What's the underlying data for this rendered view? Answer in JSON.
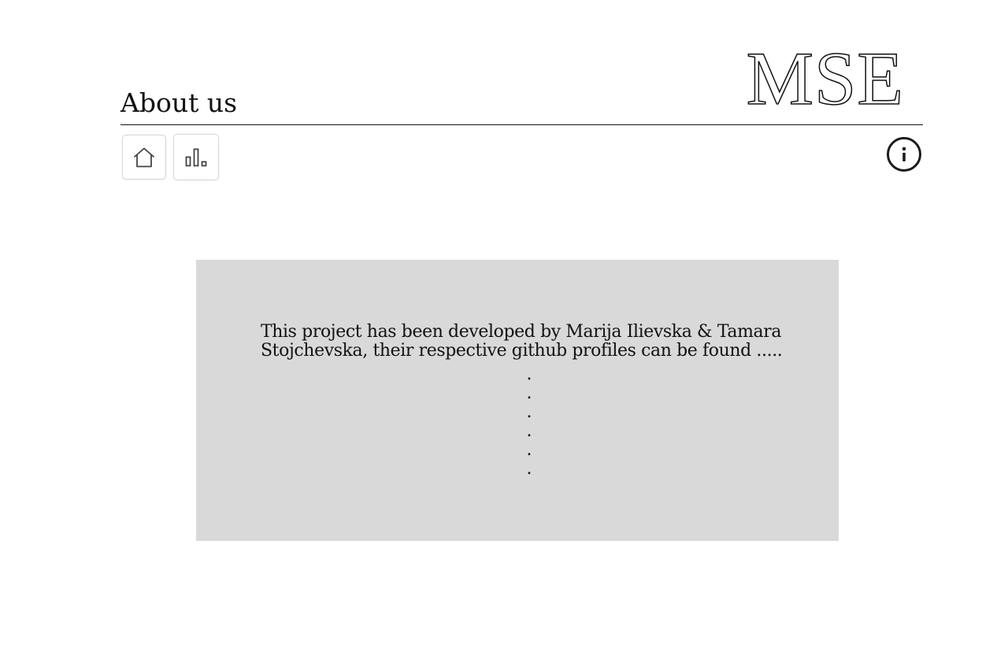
{
  "header": {
    "title": "About us",
    "logo_text": "MSE"
  },
  "nav": {
    "home_icon": "home-icon",
    "stats_icon": "bar-chart-icon",
    "info_icon": "info-icon"
  },
  "content": {
    "text": "This project has been developed by Marija Ilievska & Tamara Stojchevska, their respective github profiles can be found .....",
    "dots": [
      ".",
      ".",
      ".",
      ".",
      ".",
      "."
    ]
  },
  "colors": {
    "content_background": "#d9d9d9",
    "text": "#111111",
    "button_border": "#d6d6d6"
  }
}
